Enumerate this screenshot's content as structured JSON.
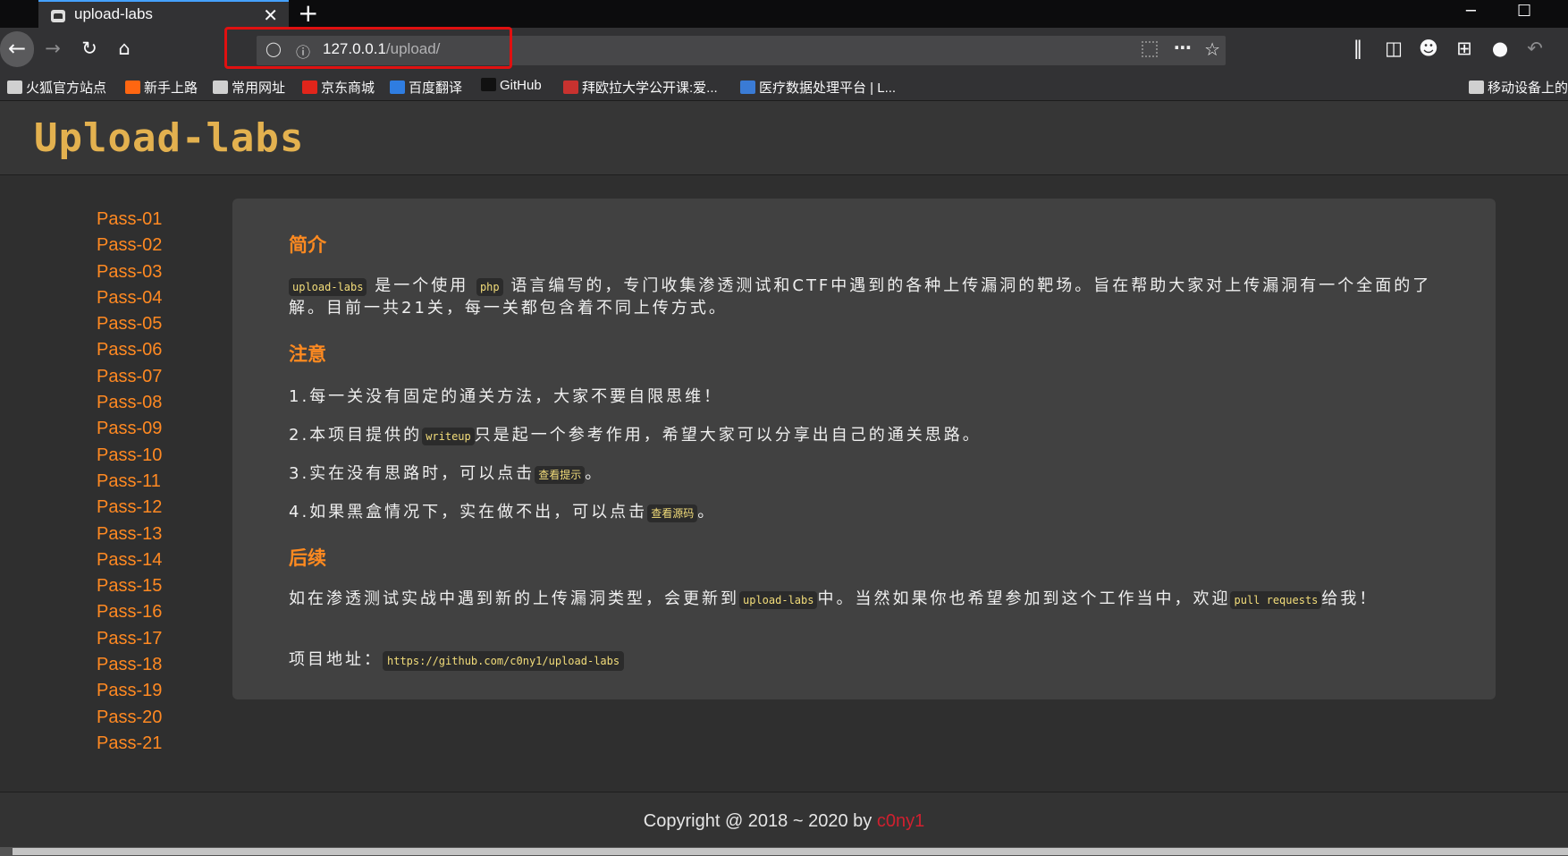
{
  "browser": {
    "tab_title": "upload-labs",
    "tab_close": "✕",
    "new_tab": "+",
    "minimize": "─",
    "maximize": "☐",
    "url_host": "127.0.0.1",
    "url_path": "/upload/",
    "bookmarks": [
      {
        "label": "火狐官方站点",
        "icon": "folder-icon",
        "color": "#d0d0d0"
      },
      {
        "label": "新手上路",
        "icon": "firefox-icon",
        "color": "#ff6611"
      },
      {
        "label": "常用网址",
        "icon": "folder-icon",
        "color": "#d0d0d0"
      },
      {
        "label": "京东商城",
        "icon": "jd-icon",
        "color": "#e1251b"
      },
      {
        "label": "百度翻译",
        "icon": "translate-icon",
        "color": "#2f7de1"
      },
      {
        "label": "GitHub",
        "icon": "github-icon",
        "color": "#111111"
      },
      {
        "label": "拜欧拉大学公开课:爱...",
        "icon": "course-icon",
        "color": "#c8322f"
      },
      {
        "label": "医疗数据处理平台 | L...",
        "icon": "diamond-icon",
        "color": "#3a7bd5"
      },
      {
        "label": "移动设备上的书",
        "icon": "mobile-icon",
        "color": "#d0d0d0"
      }
    ]
  },
  "site": {
    "logo": "Upload-labs",
    "passes": [
      "Pass-01",
      "Pass-02",
      "Pass-03",
      "Pass-04",
      "Pass-05",
      "Pass-06",
      "Pass-07",
      "Pass-08",
      "Pass-09",
      "Pass-10",
      "Pass-11",
      "Pass-12",
      "Pass-13",
      "Pass-14",
      "Pass-15",
      "Pass-16",
      "Pass-17",
      "Pass-18",
      "Pass-19",
      "Pass-20",
      "Pass-21"
    ],
    "intro": {
      "heading": "简介",
      "code1": "upload-labs",
      "text1": "是一个使用",
      "code2": "php",
      "text2": "语言编写的，专门收集渗透测试和CTF中遇到的各种上传漏洞的靶场。旨在帮助大家对上传漏洞有一个全面的了解。目前一共21关，每一关都包含着不同上传方式。"
    },
    "notice": {
      "heading": "注意",
      "item1": "1.每一关没有固定的通关方法，大家不要自限思维！",
      "item2_pre": "2.本项目提供的",
      "item2_code": "writeup",
      "item2_post": "只是起一个参考作用，希望大家可以分享出自己的通关思路。",
      "item3_pre": "3.实在没有思路时，可以点击",
      "item3_code": "查看提示",
      "item3_post": "。",
      "item4_pre": "4.如果黑盒情况下，实在做不出，可以点击",
      "item4_code": "查看源码",
      "item4_post": "。"
    },
    "followup": {
      "heading": "后续",
      "text_pre": "如在渗透测试实战中遇到新的上传漏洞类型，会更新到",
      "code1": "upload-labs",
      "text_mid": "中。当然如果你也希望参加到这个工作当中，欢迎",
      "code2": "pull requests",
      "text_post": "给我！",
      "project_label": "项目地址：",
      "project_url": "https://github.com/c0ny1/upload-labs"
    },
    "footer": {
      "copyright": "Copyright @ 2018 ~ 2020 by ",
      "author": "c0ny1"
    }
  }
}
